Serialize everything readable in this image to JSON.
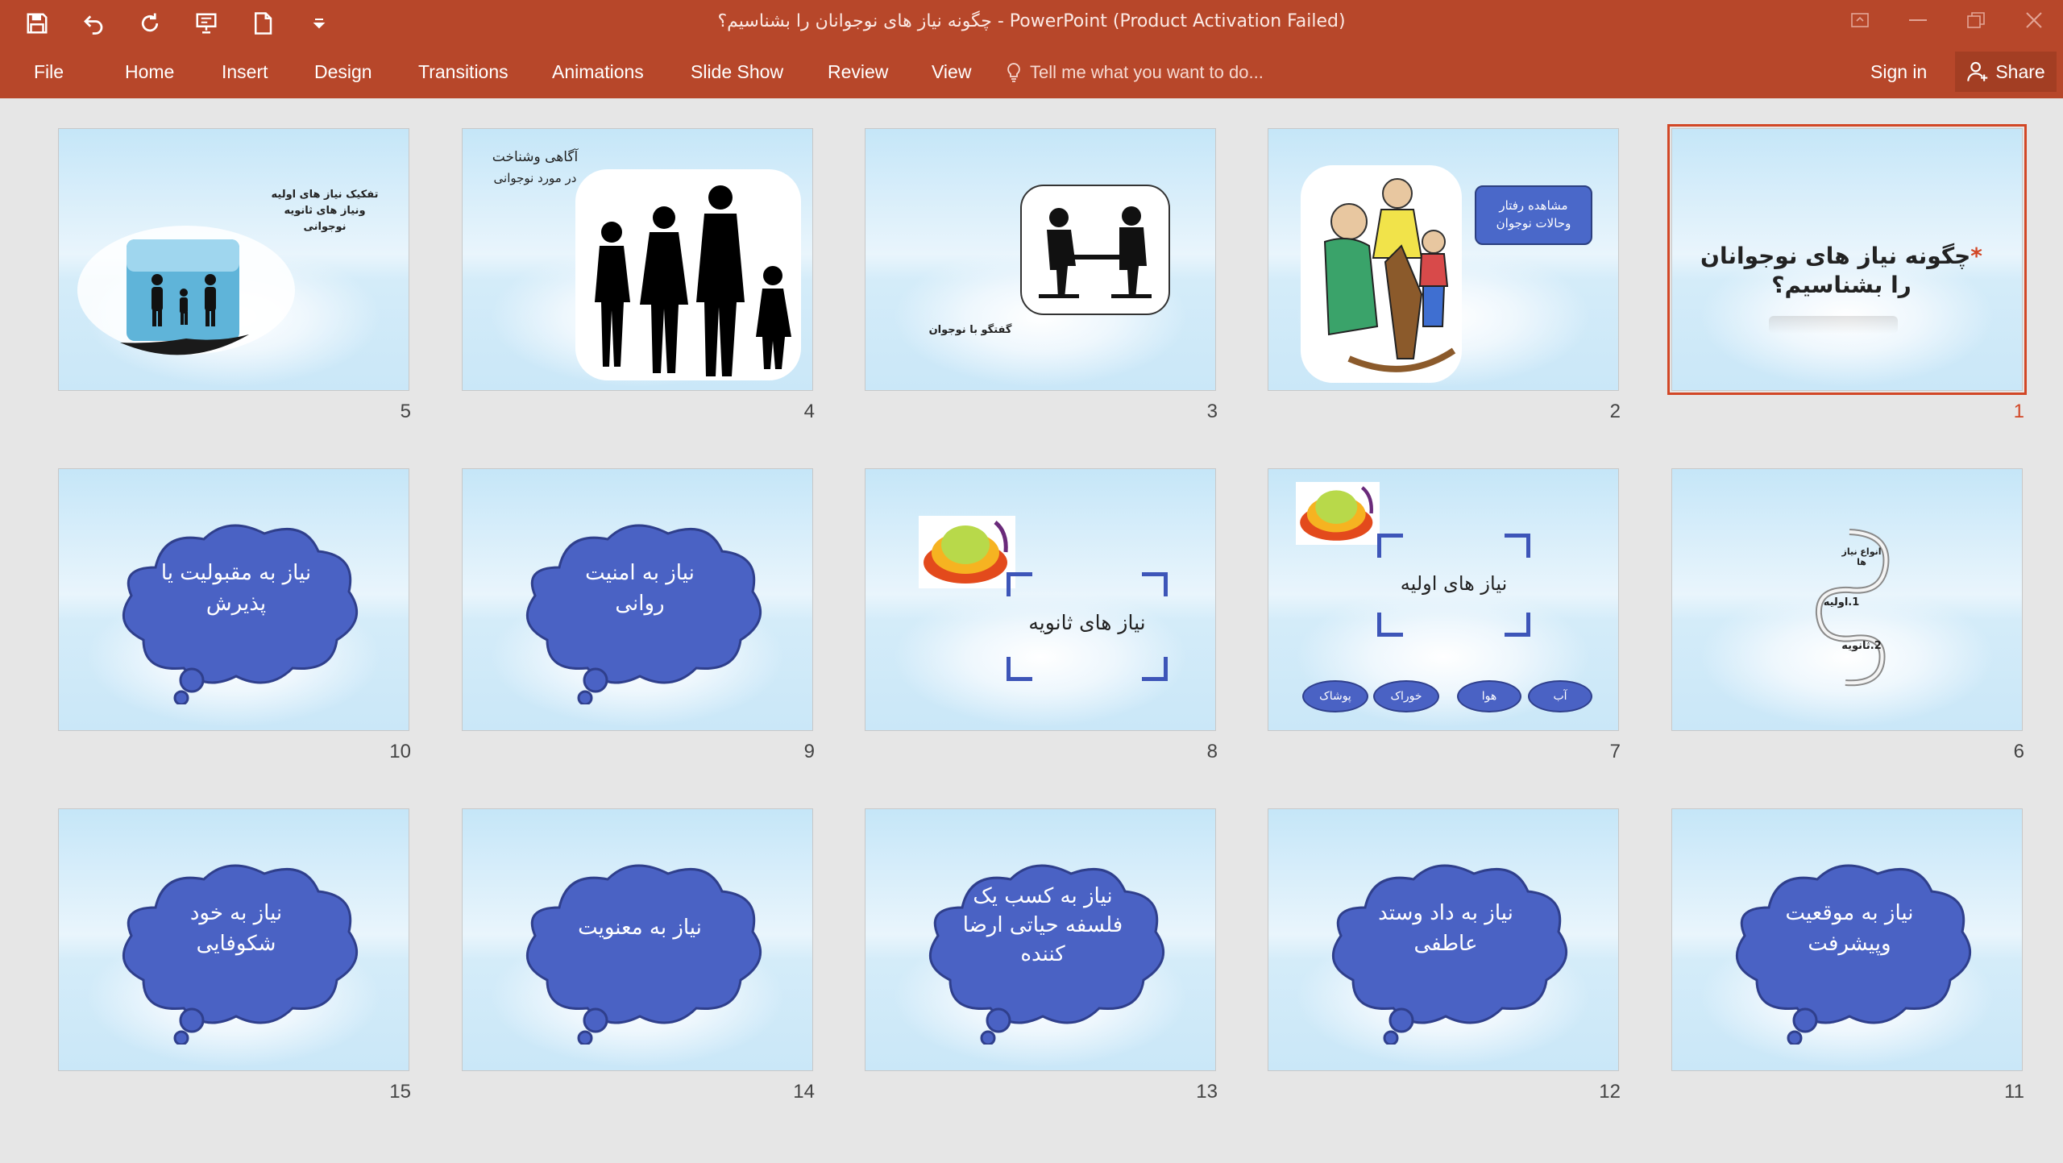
{
  "window": {
    "title": "چگونه نیاز های نوجوانان را بشناسیم؟ - PowerPoint (Product Activation Failed)",
    "accent": "#b7472a",
    "selection_color": "#d24726"
  },
  "quick_access": [
    {
      "icon": "save-icon"
    },
    {
      "icon": "undo-icon"
    },
    {
      "icon": "redo-icon"
    },
    {
      "icon": "present-icon"
    },
    {
      "icon": "new-file-icon"
    },
    {
      "icon": "customize-dropdown-icon"
    }
  ],
  "ribbon": {
    "tabs": [
      "File",
      "Home",
      "Insert",
      "Design",
      "Transitions",
      "Animations",
      "Slide Show",
      "Review",
      "View"
    ],
    "tell_me": "Tell me what you want to do...",
    "sign_in": "Sign in",
    "share": "Share"
  },
  "slides": [
    {
      "num": "1",
      "type": "title",
      "selected": true,
      "title_line1": "چگونه نیاز های نوجوانان",
      "title_line2": "را بشناسیم؟",
      "bullet": "*"
    },
    {
      "num": "2",
      "type": "family-rocking",
      "box_line1": "مشاهده رفتار",
      "box_line2": "وحالات نوجوان"
    },
    {
      "num": "3",
      "type": "conversation",
      "caption": "گفتگو با نوجوان"
    },
    {
      "num": "4",
      "type": "silhouette",
      "line1": "آگاهی وشناخت",
      "line2": "در مورد نوجوانی"
    },
    {
      "num": "5",
      "type": "hand-family",
      "line1": "تفکیک نیاز های اولیه",
      "line2": "ونیاز های ثانویه",
      "line3": "نوجوانی"
    },
    {
      "num": "6",
      "type": "spiral",
      "line1": "انواع نیاز",
      "line2": "ها",
      "line3": "1.اولیه",
      "line4": "2.ثانویه"
    },
    {
      "num": "7",
      "type": "primary-needs",
      "heading": "نیاز های اولیه",
      "ovals": [
        "آب",
        "هوا",
        "خوراک",
        "پوشاک"
      ]
    },
    {
      "num": "8",
      "type": "secondary-needs",
      "heading": "نیاز های ثانویه"
    },
    {
      "num": "9",
      "type": "cloud",
      "lines": [
        "نیاز به امنیت",
        "روانی"
      ]
    },
    {
      "num": "10",
      "type": "cloud",
      "lines": [
        "نیاز به مقبولیت یا",
        "پذیرش"
      ]
    },
    {
      "num": "11",
      "type": "cloud",
      "lines": [
        "نیاز به موقعیت",
        "وپیشرفت"
      ]
    },
    {
      "num": "12",
      "type": "cloud",
      "lines": [
        "نیاز به داد وستد",
        "عاطفی"
      ]
    },
    {
      "num": "13",
      "type": "cloud",
      "lines": [
        "نیاز به کسب یک",
        "فلسفه حیاتی ارضا",
        "کننده"
      ]
    },
    {
      "num": "14",
      "type": "cloud",
      "lines": [
        "نیاز به معنویت"
      ]
    },
    {
      "num": "15",
      "type": "cloud",
      "lines": [
        "نیاز به خود",
        "شکوفایی"
      ]
    }
  ]
}
